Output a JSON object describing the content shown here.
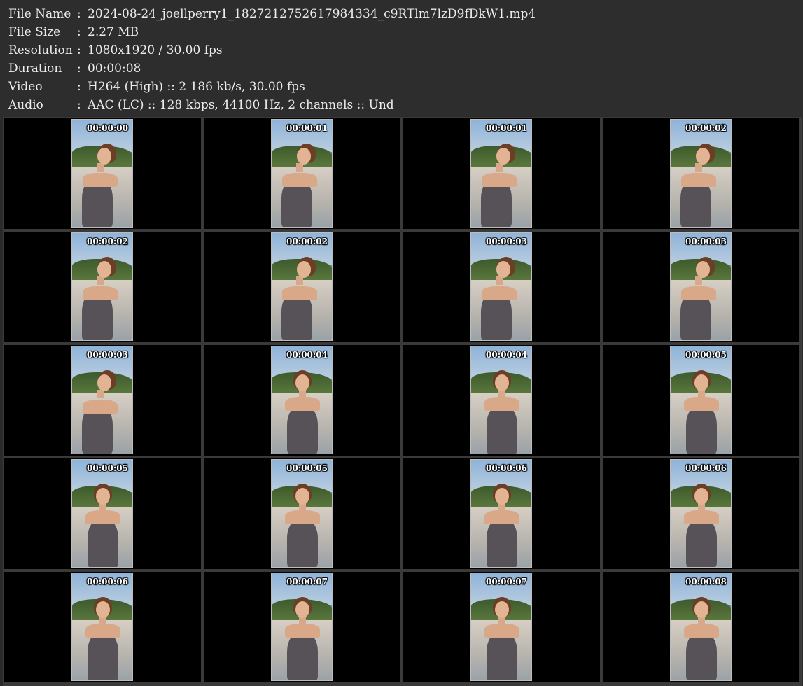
{
  "info": [
    {
      "label": "File Name",
      "sep": ":",
      "value": "2024-08-24_joellperry1_1827212752617984334_c9RTlm7lzD9fDkW1.mp4"
    },
    {
      "label": "File Size",
      "sep": ":",
      "value": "2.27 MB"
    },
    {
      "label": "Resolution",
      "sep": ":",
      "value": "1080x1920 / 30.00 fps"
    },
    {
      "label": "Duration",
      "sep": ":",
      "value": "00:00:08"
    },
    {
      "label": "Video",
      "sep": ":",
      "value": "H264 (High) :: 2 186 kb/s, 30.00 fps"
    },
    {
      "label": "Audio",
      "sep": ":",
      "value": "AAC (LC) :: 128 kbps, 44100 Hz, 2 channels :: Und"
    }
  ],
  "thumbnails": [
    {
      "time": "00:00:00",
      "pose": "side"
    },
    {
      "time": "00:00:01",
      "pose": "side"
    },
    {
      "time": "00:00:01",
      "pose": "side"
    },
    {
      "time": "00:00:02",
      "pose": "side"
    },
    {
      "time": "00:00:02",
      "pose": "side"
    },
    {
      "time": "00:00:02",
      "pose": "side"
    },
    {
      "time": "00:00:03",
      "pose": "side"
    },
    {
      "time": "00:00:03",
      "pose": "side"
    },
    {
      "time": "00:00:03",
      "pose": "side"
    },
    {
      "time": "00:00:04",
      "pose": "front"
    },
    {
      "time": "00:00:04",
      "pose": "front"
    },
    {
      "time": "00:00:05",
      "pose": "front"
    },
    {
      "time": "00:00:05",
      "pose": "front"
    },
    {
      "time": "00:00:05",
      "pose": "front"
    },
    {
      "time": "00:00:06",
      "pose": "front"
    },
    {
      "time": "00:00:06",
      "pose": "front"
    },
    {
      "time": "00:00:06",
      "pose": "front"
    },
    {
      "time": "00:00:07",
      "pose": "front"
    },
    {
      "time": "00:00:07",
      "pose": "front"
    },
    {
      "time": "00:00:08",
      "pose": "front"
    }
  ]
}
